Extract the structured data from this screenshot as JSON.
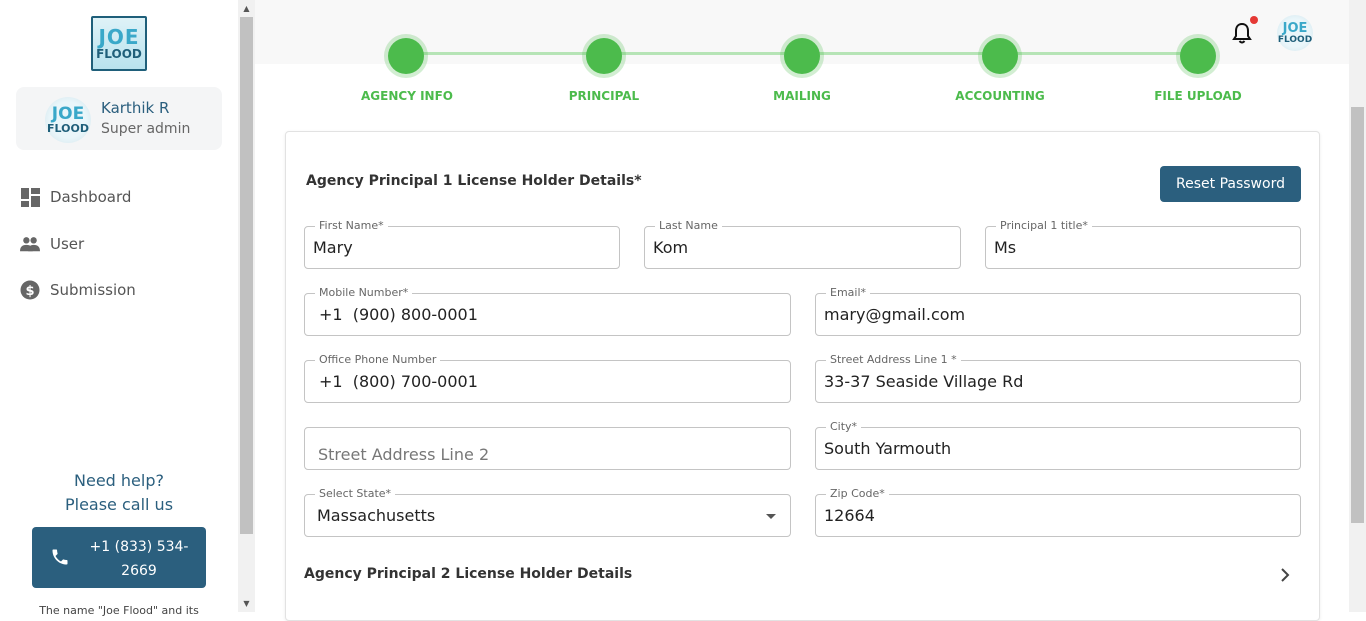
{
  "brand": {
    "logo_line1": "JOE",
    "logo_line2": "FLOOD"
  },
  "profile": {
    "name": "Karthik R",
    "role": "Super admin"
  },
  "nav": {
    "items": [
      {
        "label": "Dashboard",
        "icon": "dashboard-icon"
      },
      {
        "label": "User",
        "icon": "people-icon"
      },
      {
        "label": "Submission",
        "icon": "dollar-circle-icon"
      }
    ]
  },
  "help": {
    "line1": "Need help?",
    "line2": "Please call us",
    "phone_line1": "+1 (833) 534-",
    "phone_line2": "2669",
    "footnote": "The name \"Joe Flood\" and its"
  },
  "header": {
    "notification_icon": "bell-icon",
    "has_unread": true
  },
  "stepper": {
    "steps": [
      "AGENCY INFO",
      "PRINCIPAL",
      "MAILING",
      "ACCOUNTING",
      "FILE UPLOAD"
    ],
    "color": "#4cbb4c"
  },
  "form": {
    "title": "Agency Principal 1 License Holder Details*",
    "reset_label": "Reset Password",
    "first_name": {
      "label": "First Name*",
      "value": "Mary"
    },
    "last_name": {
      "label": "Last Name",
      "value": "Kom"
    },
    "title_field": {
      "label": "Principal 1 title*",
      "value": "Ms"
    },
    "mobile": {
      "label": "Mobile Number*",
      "value": "+1  (900) 800-0001"
    },
    "email": {
      "label": "Email*",
      "value": "mary@gmail.com"
    },
    "office_phone": {
      "label": "Office Phone Number",
      "value": "+1  (800) 700-0001"
    },
    "street1": {
      "label": "Street Address Line 1 *",
      "value": "33-37 Seaside Village Rd"
    },
    "street2": {
      "placeholder": "Street Address Line 2"
    },
    "city": {
      "label": "City*",
      "value": "South Yarmouth"
    },
    "state": {
      "label": "Select State*",
      "value": "Massachusetts"
    },
    "zip": {
      "label": "Zip Code*",
      "value": "12664"
    },
    "section2_title": "Agency Principal 2 License Holder Details"
  },
  "colors": {
    "primary": "#2b5f7e",
    "accent_green": "#4cbb4c",
    "badge_red": "#e53935"
  }
}
